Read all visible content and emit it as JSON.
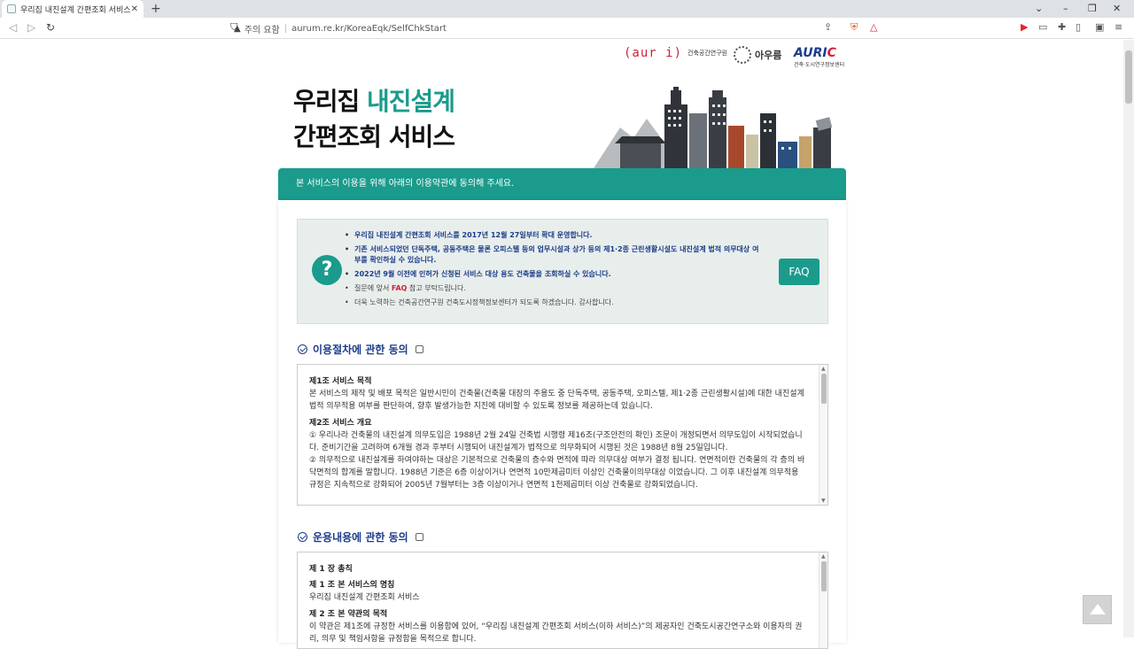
{
  "browser": {
    "tab_title": "우리집 내진설계 간편조회 서비스",
    "tab_close": "✕",
    "new_tab": "+",
    "security_label": "주의 요함",
    "url": "aurum.re.kr/KoreaEqk/SelfChkStart",
    "shield_badge": "4"
  },
  "logos": {
    "auri_mark": "(aur i)",
    "auri_text": "건축공간연구원",
    "ou_text": "아우름",
    "auric_mark_a": "AURI",
    "auric_mark_c": "C",
    "auric_sub": "건축·도시연구정보센터"
  },
  "hero": {
    "line1_plain": "우리집 ",
    "line1_accent": "내진설계",
    "line2": "간편조회 서비스"
  },
  "banner": {
    "text": "본 서비스의 이용을 위해 아래의 이용약관에 동의해 주세요."
  },
  "notice": {
    "items": [
      "우리집 내진설계 간편조회 서비스를 2017년 12월 27일부터 확대 운영합니다.",
      "기존 서비스되었던 단독주택, 공동주택은 물론 오피스텔 등의 업무시설과 상가 등의 제1·2종 근린생활시설도 내진설계 법적 의무대상 여부를 확인하실 수 있습니다.",
      "2022년 9월 이전에 인허가 신청된 서비스 대상 용도 건축물을 조회하실 수 있습니다.",
      "더욱 노력하는 건축공간연구원 건축도시정책정보센터가 되도록 하겠습니다. 감사합니다."
    ],
    "faq_line_pre": "질문에 앞서 ",
    "faq_line_word": "FAQ",
    "faq_line_post": " 참고 부탁드립니다.",
    "faq_button": "FAQ",
    "question_mark": "?"
  },
  "section1": {
    "title": "이용절차에 관한 동의",
    "h1": "제1조 서비스 목적",
    "p1": "본 서비스의 제작 및 배포 목적은 일반시민이 건축물(건축물 대장의 주용도 중 단독주택, 공동주택, 오피스텔, 제1·2종 근린생활시설)에 대한 내진설계 법적 의무적용 여부를 판단하여, 향후 발생가능한 지진에 대비할 수 있도록 정보를 제공하는데 있습니다.",
    "h2": "제2조 서비스 개요",
    "p2": "① 우리나라 건축물의 내진설계 의무도입은 1988년 2월 24일 건축법 시행령 제16조(구조안전의 확인) 조문이 개정되면서 의무도입이 시작되었습니다. 준비기간을 고려하여 6개월 경과 후부터 시행되어 내진설계가 법적으로 의무화되어 시행된 것은 1988년 8월 25일입니다.",
    "p3": "② 의무적으로 내진설계를 하여야하는 대상은 기본적으로 건축물의 층수와 면적에 따라 의무대상 여부가 결정 됩니다. 연면적이란 건축물의 각 층의 바닥면적의 합계를 말합니다. 1988년 기준은 6층 이상이거나 연면적 10만제곱미터 이상인 건축물이의무대상 이었습니다. 그 이후 내진설계 의무적용 규정은 지속적으로 강화되어 2005년 7월부터는 3층 이상이거나 연면적 1천제곱미터 이상 건축물로 강화되었습니다."
  },
  "section2": {
    "title": "운용내용에 관한 동의",
    "h0": "제 1 장 총칙",
    "h1": "제 1 조 본 서비스의 명칭",
    "p1": "우리집 내진설계 간편조회 서비스",
    "h2": "제 2 조 본 약관의 목적",
    "p2": "이 약관은 제1조에 규정한 서비스를 이용함에 있어, “우리집 내진설계 간편조회 서비스(이하 서비스)”의 제공자인 건축도시공간연구소와 이용자의 권리, 의무 및 책임사항을 규정함을 목적으로 합니다."
  },
  "colors": {
    "accent": "#1a9b8c",
    "navy": "#1b3c8a",
    "red": "#d21f3c"
  }
}
